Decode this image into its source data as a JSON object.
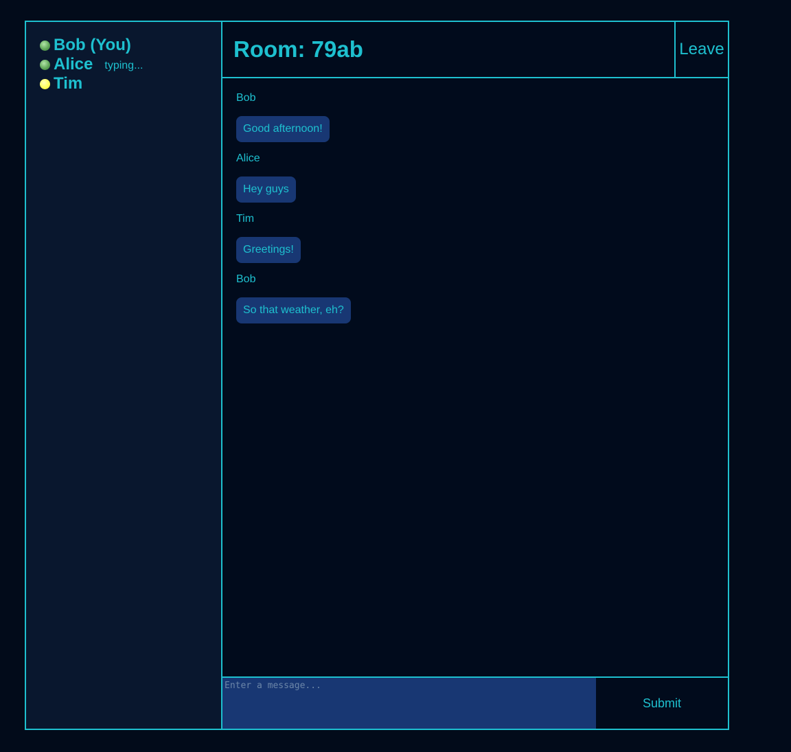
{
  "users": [
    {
      "name": "Bob (You)",
      "status": "online",
      "status_color": "#62a85a",
      "typing": ""
    },
    {
      "name": "Alice",
      "status": "online",
      "status_color": "#62a85a",
      "typing": "typing..."
    },
    {
      "name": "Tim",
      "status": "away",
      "status_color": "#ffff5c",
      "typing": ""
    }
  ],
  "header": {
    "room_title": "Room: 79ab",
    "leave_label": "Leave"
  },
  "messages": [
    {
      "author": "Bob",
      "text": "Good afternoon!"
    },
    {
      "author": "Alice",
      "text": "Hey guys"
    },
    {
      "author": "Tim",
      "text": "Greetings!"
    },
    {
      "author": "Bob",
      "text": "So that weather, eh?"
    }
  ],
  "composer": {
    "placeholder": "Enter a message...",
    "value": "",
    "submit_label": "Submit"
  },
  "colors": {
    "accent": "#1ec0cf",
    "bubble": "#183773",
    "sidebar_bg": "#09172e",
    "page_bg": "#020b1a"
  }
}
